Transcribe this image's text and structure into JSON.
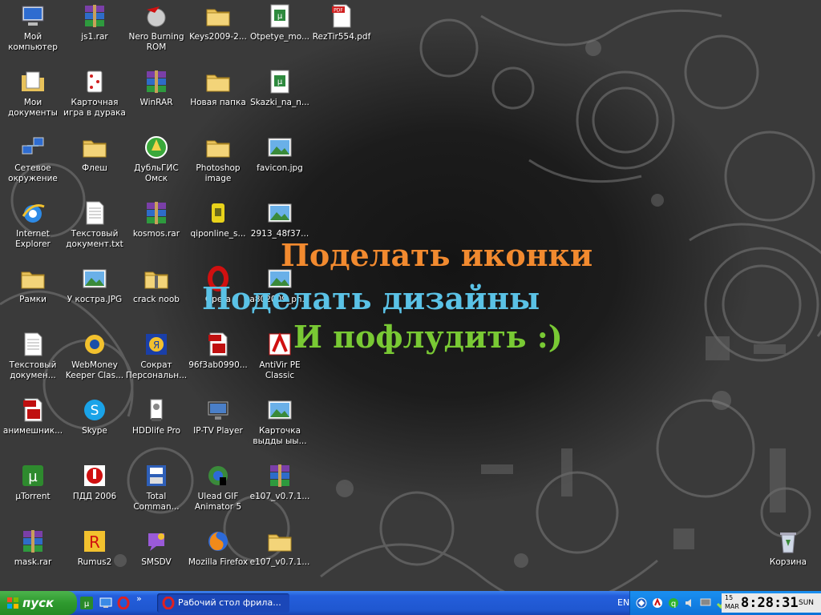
{
  "desktop": {
    "icons": [
      {
        "label": "Мой компьютер",
        "icon": "my-computer-icon"
      },
      {
        "label": "js1.rar",
        "icon": "winrar-archive-icon"
      },
      {
        "label": "Nero Burning ROM",
        "icon": "nero-icon"
      },
      {
        "label": "Keys2009-2...",
        "icon": "folder-icon"
      },
      {
        "label": "Otpetye_mo...",
        "icon": "djvu-document-icon"
      },
      {
        "label": "RezTir554.pdf",
        "icon": "pdf-icon"
      },
      {
        "label": "Мои документы",
        "icon": "my-documents-icon"
      },
      {
        "label": "Карточная игра в дурака",
        "icon": "card-game-icon"
      },
      {
        "label": "WinRAR",
        "icon": "winrar-archive-icon"
      },
      {
        "label": "Новая папка",
        "icon": "folder-icon"
      },
      {
        "label": "Skazki_na_n...",
        "icon": "djvu-document-icon"
      },
      {
        "label": "Сетевое окружение",
        "icon": "network-icon"
      },
      {
        "label": "Флеш",
        "icon": "folder-icon"
      },
      {
        "label": "ДубльГИС Омск",
        "icon": "dublgis-icon"
      },
      {
        "label": "Photoshop image",
        "icon": "folder-icon"
      },
      {
        "label": "favicon.jpg",
        "icon": "image-icon"
      },
      {
        "label": "Internet Explorer",
        "icon": "internet-explorer-icon"
      },
      {
        "label": "Текстовый документ.txt",
        "icon": "text-file-icon"
      },
      {
        "label": "kosmos.rar",
        "icon": "winrar-archive-icon"
      },
      {
        "label": "qiponline_s...",
        "icon": "qip-icon"
      },
      {
        "label": "2913_48f37...",
        "icon": "image-icon"
      },
      {
        "label": "Рамки",
        "icon": "folder-icon"
      },
      {
        "label": "У костра.JPG",
        "icon": "image-icon"
      },
      {
        "label": "crack noob",
        "icon": "zip-folder-icon"
      },
      {
        "label": "Opera",
        "icon": "opera-icon"
      },
      {
        "label": "a802009_ph...",
        "icon": "image-icon"
      },
      {
        "label": "Текстовый докумен...",
        "icon": "text-file-icon"
      },
      {
        "label": "WebMoney Keeper Clas...",
        "icon": "webmoney-icon"
      },
      {
        "label": "Сократ Персональн...",
        "icon": "socrat-icon"
      },
      {
        "label": "96f3ab0990...",
        "icon": "flv-video-icon"
      },
      {
        "label": "AntiVir PE Classic",
        "icon": "antivir-icon"
      },
      {
        "label": "анимешник...",
        "icon": "flv-video-icon"
      },
      {
        "label": "Skype",
        "icon": "skype-icon"
      },
      {
        "label": "HDDlife Pro",
        "icon": "hddlife-icon"
      },
      {
        "label": "IP-TV Player",
        "icon": "iptv-player-icon"
      },
      {
        "label": "Карточка выдды ыы...",
        "icon": "image-icon"
      },
      {
        "label": "µTorrent",
        "icon": "utorrent-icon"
      },
      {
        "label": "ПДД 2006",
        "icon": "pdd-icon"
      },
      {
        "label": "Total Comman...",
        "icon": "total-commander-icon"
      },
      {
        "label": "Ulead GIF Animator 5",
        "icon": "ulead-gif-icon"
      },
      {
        "label": "e107_v0.7.1...",
        "icon": "winrar-archive-icon"
      },
      {
        "label": "mask.rar",
        "icon": "winrar-archive-icon"
      },
      {
        "label": "Rumus2",
        "icon": "rumus-icon"
      },
      {
        "label": "SMSDV",
        "icon": "smsdv-icon"
      },
      {
        "label": "Mozilla Firefox",
        "icon": "firefox-icon"
      },
      {
        "label": "e107_v0.7.1...",
        "icon": "folder-icon"
      },
      {
        "label": "Корзина",
        "icon": "recycle-bin-icon"
      }
    ],
    "slogans": [
      "Поделать иконки",
      "Поделать дизайны",
      "И пофлудить :)"
    ]
  },
  "taskbar": {
    "start_label": "пуск",
    "quick_launch": [
      "utorrent-icon",
      "desktop-icon",
      "opera-icon"
    ],
    "tasks": [
      {
        "label": "Рабочий стол фрила...",
        "icon": "opera-icon"
      }
    ],
    "language": "EN",
    "tray_icons": [
      "network-icon",
      "antivirus-icon",
      "qip-icon",
      "sound-icon",
      "display-icon",
      "safely-remove-icon",
      "wifi-icon"
    ],
    "clock": {
      "day": "15",
      "month": "MAR",
      "time": "8:28:31",
      "weekday": "SUN"
    }
  },
  "colors": {
    "slogan1": "#f28a2f",
    "slogan2": "#5ac2e6",
    "slogan3": "#79c934",
    "taskbar": "#245edb",
    "start": "#2e9a2e"
  }
}
